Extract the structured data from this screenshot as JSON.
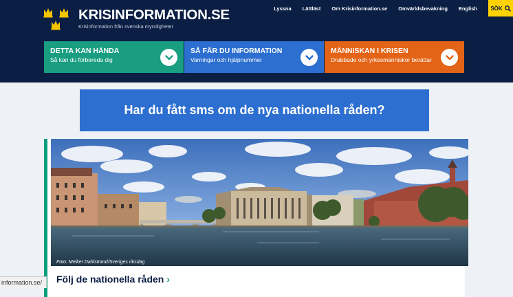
{
  "site": {
    "name": "KRISINFORMATION.SE",
    "tagline": "Krisinformation från svenska myndigheter"
  },
  "topnav": {
    "items": [
      "Lyssna",
      "Lättläst",
      "Om Krisinformation.se",
      "Omvärldsbevakning",
      "English"
    ],
    "search_label": "SÖK"
  },
  "tiles": [
    {
      "title": "DETTA KAN HÄNDA",
      "subtitle": "Så kan du förbereda dig",
      "color": "#1a9e82"
    },
    {
      "title": "SÅ FÅR DU INFORMATION",
      "subtitle": "Varningar och hjälpnummer",
      "color": "#2d6fd0"
    },
    {
      "title": "MÄNNISKAN I KRISEN",
      "subtitle": "Drabbade och yrkesmänniskor berättar",
      "color": "#e46417"
    }
  ],
  "banner": {
    "text": "Har du fått sms om de nya nationella råden?"
  },
  "card": {
    "photo_credit": "Foto: Melker Dahlstrand/Sveriges riksdag",
    "link_text": "Följ de nationella råden"
  },
  "status_bar": {
    "url": "information.se/"
  },
  "colors": {
    "header": "#0b1e44",
    "accent_yellow": "#ffd200",
    "accent_green": "#0f9e7f"
  }
}
